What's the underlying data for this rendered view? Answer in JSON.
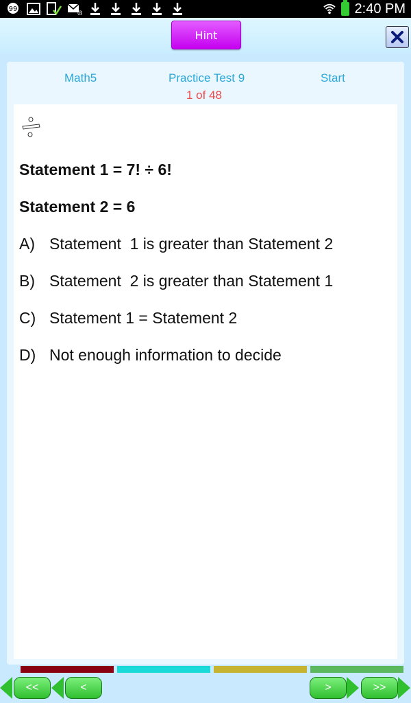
{
  "status_bar": {
    "time": "2:40 PM",
    "icons": [
      "hangouts-icon",
      "gallery-icon",
      "task-icon",
      "email-icon",
      "download-icon",
      "download-icon",
      "download-icon",
      "download-icon",
      "download-icon"
    ]
  },
  "toolbar": {
    "hint_label": "Hint",
    "close_icon": "close-icon"
  },
  "header": {
    "subject": "Math5",
    "test_name": "Practice Test 9",
    "start": "Start",
    "progress": "1 of 48"
  },
  "question": {
    "icon": "division-icon",
    "statement1": "Statement 1 = 7! ÷ 6!",
    "statement2": "Statement 2 = 6",
    "options": [
      {
        "letter": "A)",
        "text": "Statement  1 is greater than Statement 2"
      },
      {
        "letter": "B)",
        "text": "Statement  2 is greater than Statement 1"
      },
      {
        "letter": "C)",
        "text": "Statement 1 = Statement 2"
      },
      {
        "letter": "D)",
        "text": "Not enough information to decide"
      }
    ]
  },
  "answers": {
    "a": "A",
    "b": "B",
    "c": "C",
    "d": "D",
    "colors": {
      "a": "#8a0010",
      "b": "#1ad9d9",
      "c": "#c6b431",
      "d": "#5cb85c"
    }
  },
  "navigation": {
    "first": "<<",
    "prev": "<",
    "next": ">",
    "last": ">>"
  }
}
